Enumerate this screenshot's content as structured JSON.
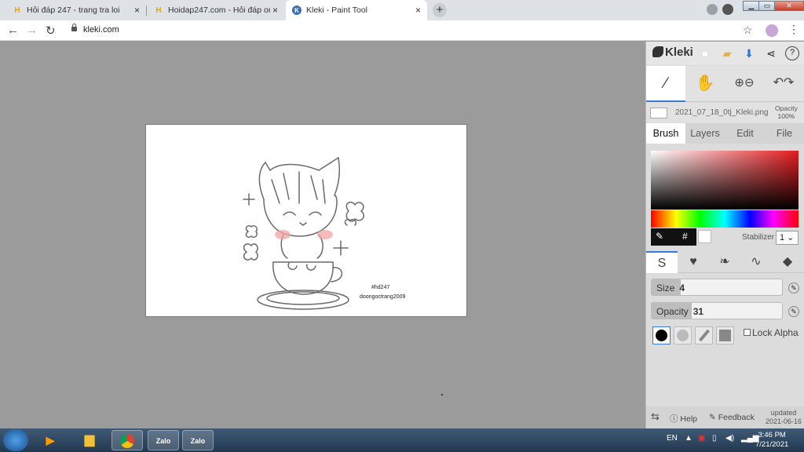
{
  "browser": {
    "tabs": [
      {
        "title": "Hỏi đáp 247 - trang tra loi",
        "close": "×"
      },
      {
        "title": "Hoidap247.com - Hỏi đáp online",
        "close": "×"
      },
      {
        "title": "Kleki - Paint Tool",
        "close": "×"
      }
    ],
    "new_tab": "+",
    "address": "kleki.com",
    "window_controls": {
      "minimize": "▁",
      "maximize": "▭",
      "close": "✕"
    }
  },
  "canvas": {
    "signature_line1": "#hd247",
    "signature_line2": "doongoctrang2009"
  },
  "kleki": {
    "logo": "Kleki",
    "file_name": "2021_07_18_0tj_Kleki.png",
    "layer_opacity_label": "Opacity",
    "layer_opacity_value": "100%",
    "tabs": [
      "Brush",
      "Layers",
      "Edit",
      "File"
    ],
    "active_tab": "Brush",
    "picker_hash": "#",
    "stabilizer_label": "Stabilizer",
    "stabilizer_value": "1",
    "size_label": "Size",
    "size_value": "4",
    "size_fraction": 0.22,
    "opacity_label": "Opacity",
    "opacity_value": "31",
    "opacity_fraction": 0.31,
    "lock_alpha_label": "Lock Alpha",
    "footer": {
      "help": "Help",
      "feedback": "Feedback",
      "updated_label": "updated",
      "updated_date": "2021-06-16"
    },
    "colors": {
      "accent": "#3a7ad8",
      "hue_red": "#e51c20"
    }
  },
  "taskbar": {
    "language": "EN",
    "time": "3:46 PM",
    "date": "7/21/2021",
    "zalo_label": "Zalo"
  }
}
